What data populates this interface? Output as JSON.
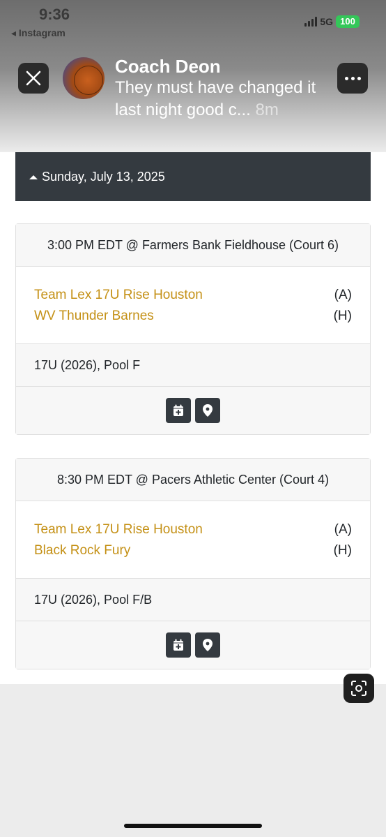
{
  "status_bar": {
    "time": "9:36",
    "back_app": "◂ Instagram",
    "network": "5G",
    "battery": "100"
  },
  "notification": {
    "sender": "Coach Deon",
    "message": "They must have changed it last night good c...",
    "time_ago": "8m"
  },
  "schedule": {
    "date": "Sunday, July 13, 2025",
    "games": [
      {
        "header": "3:00 PM EDT @ Farmers Bank Fieldhouse (Court 6)",
        "team_a": "Team Lex 17U Rise Houston",
        "team_a_side": "(A)",
        "team_b": "WV Thunder Barnes",
        "team_b_side": "(H)",
        "division": "17U (2026), Pool F"
      },
      {
        "header": "8:30 PM EDT @ Pacers Athletic Center (Court 4)",
        "team_a": "Team Lex 17U Rise Houston",
        "team_a_side": "(A)",
        "team_b": "Black Rock Fury",
        "team_b_side": "(H)",
        "division": "17U (2026), Pool F/B"
      }
    ]
  },
  "colors": {
    "accent_gold": "#c49015",
    "dark_bar": "#343a40",
    "battery_green": "#34c759"
  },
  "icons": {
    "close": "close-icon",
    "more": "more-icon",
    "calendar_add": "calendar-plus-icon",
    "location": "map-pin-icon",
    "scan": "scan-text-icon"
  }
}
